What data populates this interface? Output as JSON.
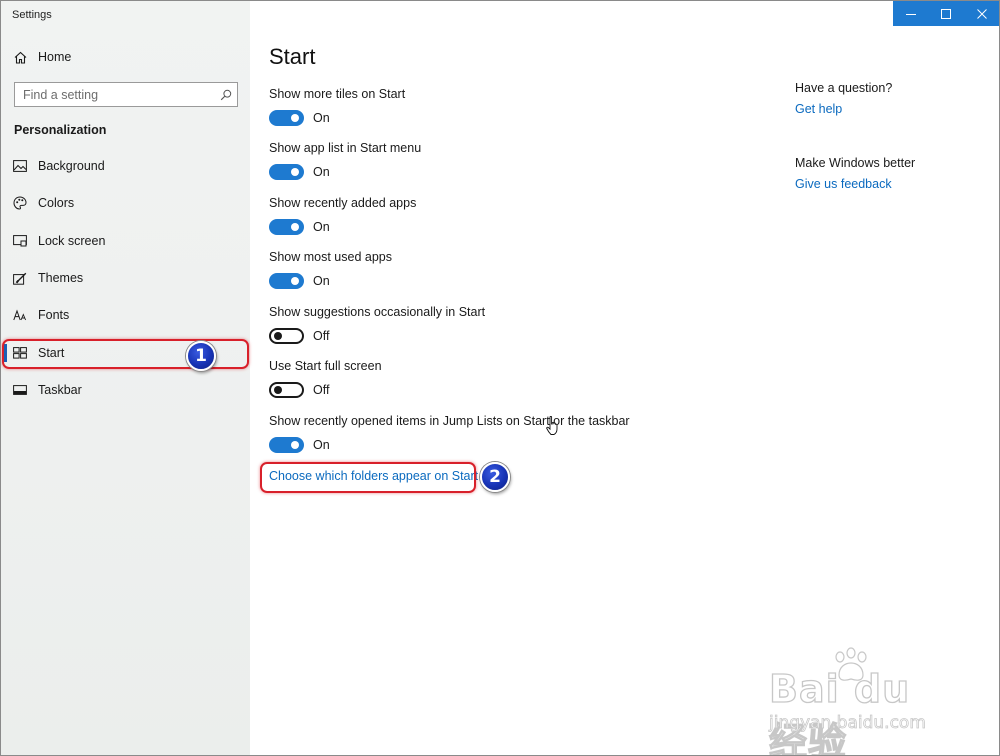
{
  "window": {
    "title": "Settings"
  },
  "colors": {
    "accent": "#1e7ad0",
    "link": "#0b6abf",
    "annotation": "#d8202a",
    "badge": "#1733b5"
  },
  "sidebar": {
    "home_label": "Home",
    "search_placeholder": "Find a setting",
    "section_heading": "Personalization",
    "items": [
      {
        "label": "Background",
        "icon": "image-icon"
      },
      {
        "label": "Colors",
        "icon": "palette-icon"
      },
      {
        "label": "Lock screen",
        "icon": "lock-screen-icon"
      },
      {
        "label": "Themes",
        "icon": "themes-icon"
      },
      {
        "label": "Fonts",
        "icon": "fonts-icon"
      },
      {
        "label": "Start",
        "icon": "start-icon",
        "selected": true
      },
      {
        "label": "Taskbar",
        "icon": "taskbar-icon"
      }
    ]
  },
  "main": {
    "title": "Start",
    "settings": [
      {
        "label": "Show more tiles on Start",
        "state": "On"
      },
      {
        "label": "Show app list in Start menu",
        "state": "On"
      },
      {
        "label": "Show recently added apps",
        "state": "On"
      },
      {
        "label": "Show most used apps",
        "state": "On"
      },
      {
        "label": "Show suggestions occasionally in Start",
        "state": "Off"
      },
      {
        "label": "Use Start full screen",
        "state": "Off"
      },
      {
        "label": "Show recently opened items in Jump Lists on Start or the taskbar",
        "state": "On"
      }
    ],
    "folders_link": "Choose which folders appear on Start"
  },
  "aside": {
    "question_heading": "Have a question?",
    "get_help": "Get help",
    "improve_heading": "Make Windows better",
    "feedback": "Give us feedback"
  },
  "annotations": {
    "badge_1": "1",
    "badge_2": "2"
  },
  "watermark": {
    "main": "Bai du 经验",
    "sub": "jingyan.baidu.com"
  }
}
